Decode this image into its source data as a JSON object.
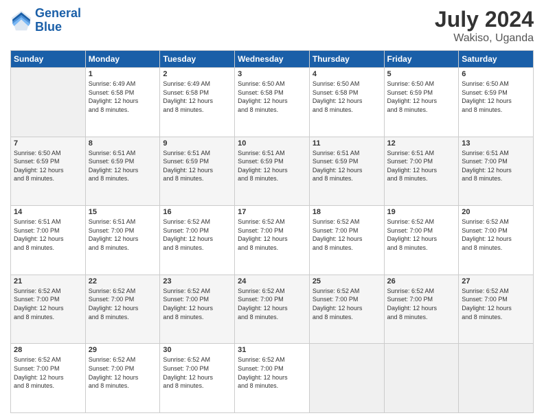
{
  "header": {
    "logo_line1": "General",
    "logo_line2": "Blue",
    "month_year": "July 2024",
    "location": "Wakiso, Uganda"
  },
  "days_of_week": [
    "Sunday",
    "Monday",
    "Tuesday",
    "Wednesday",
    "Thursday",
    "Friday",
    "Saturday"
  ],
  "weeks": [
    [
      {
        "num": "",
        "info": ""
      },
      {
        "num": "1",
        "info": "Sunrise: 6:49 AM\nSunset: 6:58 PM\nDaylight: 12 hours\nand 8 minutes."
      },
      {
        "num": "2",
        "info": "Sunrise: 6:49 AM\nSunset: 6:58 PM\nDaylight: 12 hours\nand 8 minutes."
      },
      {
        "num": "3",
        "info": "Sunrise: 6:50 AM\nSunset: 6:58 PM\nDaylight: 12 hours\nand 8 minutes."
      },
      {
        "num": "4",
        "info": "Sunrise: 6:50 AM\nSunset: 6:58 PM\nDaylight: 12 hours\nand 8 minutes."
      },
      {
        "num": "5",
        "info": "Sunrise: 6:50 AM\nSunset: 6:59 PM\nDaylight: 12 hours\nand 8 minutes."
      },
      {
        "num": "6",
        "info": "Sunrise: 6:50 AM\nSunset: 6:59 PM\nDaylight: 12 hours\nand 8 minutes."
      }
    ],
    [
      {
        "num": "7",
        "info": "Sunrise: 6:50 AM\nSunset: 6:59 PM\nDaylight: 12 hours\nand 8 minutes."
      },
      {
        "num": "8",
        "info": "Sunrise: 6:51 AM\nSunset: 6:59 PM\nDaylight: 12 hours\nand 8 minutes."
      },
      {
        "num": "9",
        "info": "Sunrise: 6:51 AM\nSunset: 6:59 PM\nDaylight: 12 hours\nand 8 minutes."
      },
      {
        "num": "10",
        "info": "Sunrise: 6:51 AM\nSunset: 6:59 PM\nDaylight: 12 hours\nand 8 minutes."
      },
      {
        "num": "11",
        "info": "Sunrise: 6:51 AM\nSunset: 6:59 PM\nDaylight: 12 hours\nand 8 minutes."
      },
      {
        "num": "12",
        "info": "Sunrise: 6:51 AM\nSunset: 7:00 PM\nDaylight: 12 hours\nand 8 minutes."
      },
      {
        "num": "13",
        "info": "Sunrise: 6:51 AM\nSunset: 7:00 PM\nDaylight: 12 hours\nand 8 minutes."
      }
    ],
    [
      {
        "num": "14",
        "info": "Sunrise: 6:51 AM\nSunset: 7:00 PM\nDaylight: 12 hours\nand 8 minutes."
      },
      {
        "num": "15",
        "info": "Sunrise: 6:51 AM\nSunset: 7:00 PM\nDaylight: 12 hours\nand 8 minutes."
      },
      {
        "num": "16",
        "info": "Sunrise: 6:52 AM\nSunset: 7:00 PM\nDaylight: 12 hours\nand 8 minutes."
      },
      {
        "num": "17",
        "info": "Sunrise: 6:52 AM\nSunset: 7:00 PM\nDaylight: 12 hours\nand 8 minutes."
      },
      {
        "num": "18",
        "info": "Sunrise: 6:52 AM\nSunset: 7:00 PM\nDaylight: 12 hours\nand 8 minutes."
      },
      {
        "num": "19",
        "info": "Sunrise: 6:52 AM\nSunset: 7:00 PM\nDaylight: 12 hours\nand 8 minutes."
      },
      {
        "num": "20",
        "info": "Sunrise: 6:52 AM\nSunset: 7:00 PM\nDaylight: 12 hours\nand 8 minutes."
      }
    ],
    [
      {
        "num": "21",
        "info": "Sunrise: 6:52 AM\nSunset: 7:00 PM\nDaylight: 12 hours\nand 8 minutes."
      },
      {
        "num": "22",
        "info": "Sunrise: 6:52 AM\nSunset: 7:00 PM\nDaylight: 12 hours\nand 8 minutes."
      },
      {
        "num": "23",
        "info": "Sunrise: 6:52 AM\nSunset: 7:00 PM\nDaylight: 12 hours\nand 8 minutes."
      },
      {
        "num": "24",
        "info": "Sunrise: 6:52 AM\nSunset: 7:00 PM\nDaylight: 12 hours\nand 8 minutes."
      },
      {
        "num": "25",
        "info": "Sunrise: 6:52 AM\nSunset: 7:00 PM\nDaylight: 12 hours\nand 8 minutes."
      },
      {
        "num": "26",
        "info": "Sunrise: 6:52 AM\nSunset: 7:00 PM\nDaylight: 12 hours\nand 8 minutes."
      },
      {
        "num": "27",
        "info": "Sunrise: 6:52 AM\nSunset: 7:00 PM\nDaylight: 12 hours\nand 8 minutes."
      }
    ],
    [
      {
        "num": "28",
        "info": "Sunrise: 6:52 AM\nSunset: 7:00 PM\nDaylight: 12 hours\nand 8 minutes."
      },
      {
        "num": "29",
        "info": "Sunrise: 6:52 AM\nSunset: 7:00 PM\nDaylight: 12 hours\nand 8 minutes."
      },
      {
        "num": "30",
        "info": "Sunrise: 6:52 AM\nSunset: 7:00 PM\nDaylight: 12 hours\nand 8 minutes."
      },
      {
        "num": "31",
        "info": "Sunrise: 6:52 AM\nSunset: 7:00 PM\nDaylight: 12 hours\nand 8 minutes."
      },
      {
        "num": "",
        "info": ""
      },
      {
        "num": "",
        "info": ""
      },
      {
        "num": "",
        "info": ""
      }
    ]
  ]
}
